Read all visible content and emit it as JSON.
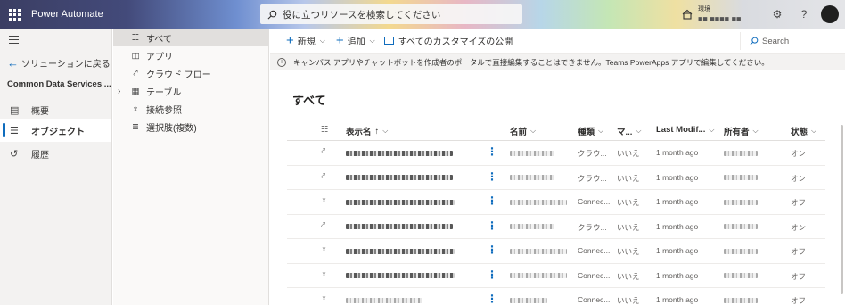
{
  "topbar": {
    "app_title": "Power Automate",
    "search_placeholder": "役に立つリソースを検索してください",
    "env_label": "環境",
    "env_value": "■■ ■■■■ ■■"
  },
  "leftnav": {
    "back_label": "ソリューションに戻る",
    "solution_name": "Common Data Services ...",
    "items": [
      {
        "label": "概要",
        "icon": "overview-icon"
      },
      {
        "label": "オブジェクト",
        "icon": "objects-icon"
      },
      {
        "label": "履歴",
        "icon": "history-icon"
      }
    ]
  },
  "objnav": {
    "items": [
      {
        "label": "すべて",
        "icon": "list-icon"
      },
      {
        "label": "アプリ",
        "icon": "app-icon"
      },
      {
        "label": "クラウド フロー",
        "icon": "flow-icon"
      },
      {
        "label": "テーブル",
        "icon": "table-icon"
      },
      {
        "label": "接続参照",
        "icon": "plug-icon"
      },
      {
        "label": "選択肢(複数)",
        "icon": "choices-icon"
      }
    ]
  },
  "cmdbar": {
    "new_label": "新規",
    "add_label": "追加",
    "publish_label": "すべてのカスタマイズの公開",
    "search_label": "Search"
  },
  "infobar": {
    "message": "キャンバス アプリやチャットボットを作成者のポータルで直接編集することはできません。Teams PowerApps アプリで編集してください。"
  },
  "main": {
    "heading": "すべて"
  },
  "table": {
    "columns": {
      "display_name": "表示名",
      "name": "名前",
      "type": "種類",
      "managed": "マ...",
      "last_modified": "Last Modif...",
      "owner": "所有者",
      "status": "状態"
    },
    "rows": [
      {
        "icon": "flow-icon",
        "type": "クラウ...",
        "managed": "いいえ",
        "modified": "1 month ago",
        "status": "オン"
      },
      {
        "icon": "flow-icon",
        "type": "クラウ...",
        "managed": "いいえ",
        "modified": "1 month ago",
        "status": "オン"
      },
      {
        "icon": "plug-icon",
        "type": "Connec...",
        "managed": "いいえ",
        "modified": "1 month ago",
        "status": "オフ"
      },
      {
        "icon": "flow-icon",
        "type": "クラウ...",
        "managed": "いいえ",
        "modified": "1 month ago",
        "status": "オン"
      },
      {
        "icon": "plug-icon",
        "type": "Connec...",
        "managed": "いいえ",
        "modified": "1 month ago",
        "status": "オフ"
      },
      {
        "icon": "plug-icon",
        "type": "Connec...",
        "managed": "いいえ",
        "modified": "1 month ago",
        "status": "オフ"
      },
      {
        "icon": "plug-icon",
        "type": "Connec...",
        "managed": "いいえ",
        "modified": "1 month ago",
        "status": "オフ"
      }
    ]
  },
  "colors": {
    "accent": "#0f6cbd",
    "nav_bg": "#f3f2f1"
  }
}
